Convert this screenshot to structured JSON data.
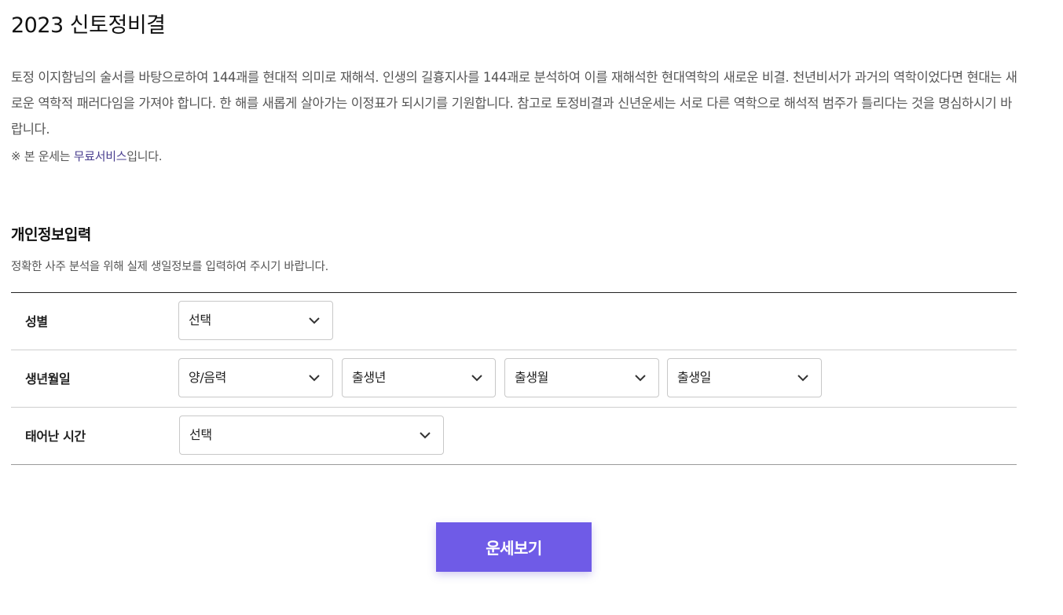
{
  "page": {
    "title": "2023 신토정비결",
    "intro": "토정 이지함님의 술서를 바탕으로하여 144괘를 현대적 의미로 재해석. 인생의 길흉지사를 144괘로 분석하여 이를 재해석한 현대역학의 새로운 비결. 천년비서가 과거의 역학이었다면 현대는 새로운 역학적 패러다임을 가져야 합니다. 한 해를 새롭게 살아가는 이정표가 되시기를 기원합니다. 참고로 토정비결과 신년운세는 서로 다른 역학으로 해석적 범주가 틀리다는 것을 명심하시기 바랍니다.",
    "note_prefix": "※ 본 운세는 ",
    "note_highlight": "무료서비스",
    "note_suffix": "입니다."
  },
  "form": {
    "title": "개인정보입력",
    "description": "정확한 사주 분석을 위해 실제 생일정보를 입력하여 주시기 바랍니다.",
    "gender": {
      "label": "성별",
      "selected": "선택"
    },
    "birth": {
      "label": "생년월일",
      "calendar_selected": "양/음력",
      "year_selected": "출생년",
      "month_selected": "출생월",
      "day_selected": "출생일"
    },
    "time": {
      "label": "태어난 시간",
      "selected": "선택"
    },
    "submit_label": "운세보기"
  },
  "icons": {
    "dropdown": "chevron-down-icon"
  },
  "colors": {
    "accent": "#6f5be7",
    "link": "#4a3f8f"
  }
}
